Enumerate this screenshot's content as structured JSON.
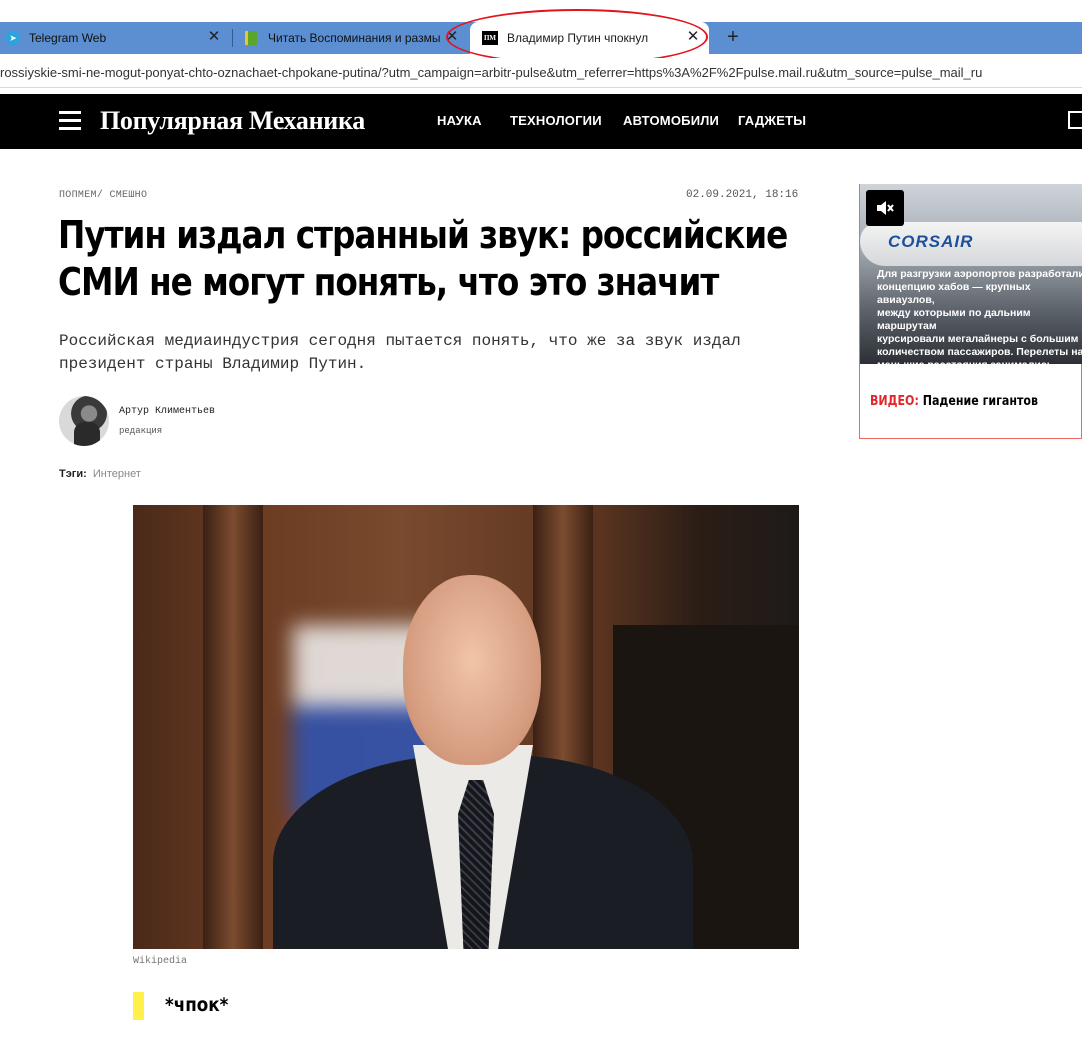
{
  "browser": {
    "tabs": [
      {
        "title": "Telegram Web",
        "active": false
      },
      {
        "title": "Читать Воспоминания и размышления",
        "active": false
      },
      {
        "title": "Владимир Путин чпокнул",
        "active": true
      }
    ],
    "new_tab_symbol": "+",
    "close_symbol": "✕",
    "url": "rossiyskie-smi-ne-mogut-ponyat-chto-oznachaet-chpokane-putina/?utm_campaign=arbitr-pulse&utm_referrer=https%3A%2F%2Fpulse.mail.ru&utm_source=pulse_mail_ru",
    "favicon_text": "ПМ",
    "annotation_color": "#e3141c"
  },
  "site": {
    "logo": "Популярная Механика",
    "nav": [
      "НАУКА",
      "ТЕХНОЛОГИИ",
      "АВТОМОБИЛИ",
      "ГАДЖЕТЫ"
    ]
  },
  "article": {
    "breadcrumb": [
      "ПОПМЕМ",
      "СМЕШНО"
    ],
    "breadcrumb_separator": "/",
    "date": "02.09.2021, 18:16",
    "headline": "Путин издал странный звук: российские СМИ не могут понять, что это значит",
    "lead": "Российская медиаиндустрия сегодня пытается понять, что же за звук издал президент страны Владимир Путин.",
    "author": {
      "name": "Артур Климентьев",
      "role": "редакция"
    },
    "tags_label": "Тэги:",
    "tags": [
      "Интернет"
    ],
    "photo_caption": "Wikipedia",
    "quote": "*чпок*",
    "quote_bar_color": "#fff04a"
  },
  "sidebar": {
    "video": {
      "thumb_brand": "CORSAIR",
      "thumb_text": "Для разгрузки аэропортов разработали\nконцепцию хабов — крупных авиаузлов,\nмежду которыми по дальним маршрутам\nкурсировали мегалайнеры с большим\nколичеством пассажиров. Перелеты на\nменьшие расстояния занимались местные",
      "kicker": "ВИДЕО:",
      "title": "Падение гигантов",
      "kicker_color": "#e1262d"
    }
  }
}
